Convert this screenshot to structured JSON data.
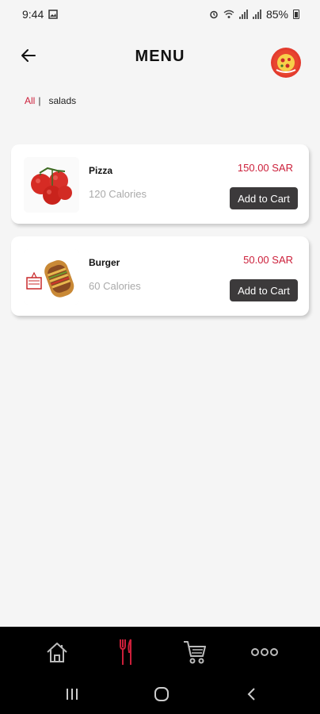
{
  "status_bar": {
    "time": "9:44",
    "battery": "85%"
  },
  "header": {
    "title": "MENU"
  },
  "tabs": [
    {
      "label": "All",
      "active": true
    },
    {
      "label": "|"
    },
    {
      "label": "salads",
      "active": false
    }
  ],
  "items": [
    {
      "name": "Pizza",
      "calories": "120 Calories",
      "price": "150.00 SAR",
      "cta": "Add to Cart",
      "image_icon": "tomatoes-image"
    },
    {
      "name": "Burger",
      "calories": "60 Calories",
      "price": "50.00 SAR",
      "cta": "Add to Cart",
      "image_icon": "sandwich-image"
    }
  ],
  "bottom_nav": [
    "home-icon",
    "menu-fork-knife-icon",
    "cart-icon",
    "more-icon"
  ],
  "system_nav": [
    "recents-icon",
    "home-circle-icon",
    "back-chevron-icon"
  ],
  "colors": {
    "accent": "#cc1f3a",
    "button_bg": "#3c3a3b",
    "nav_bg": "#000000",
    "page_bg": "#f5f5f5"
  }
}
